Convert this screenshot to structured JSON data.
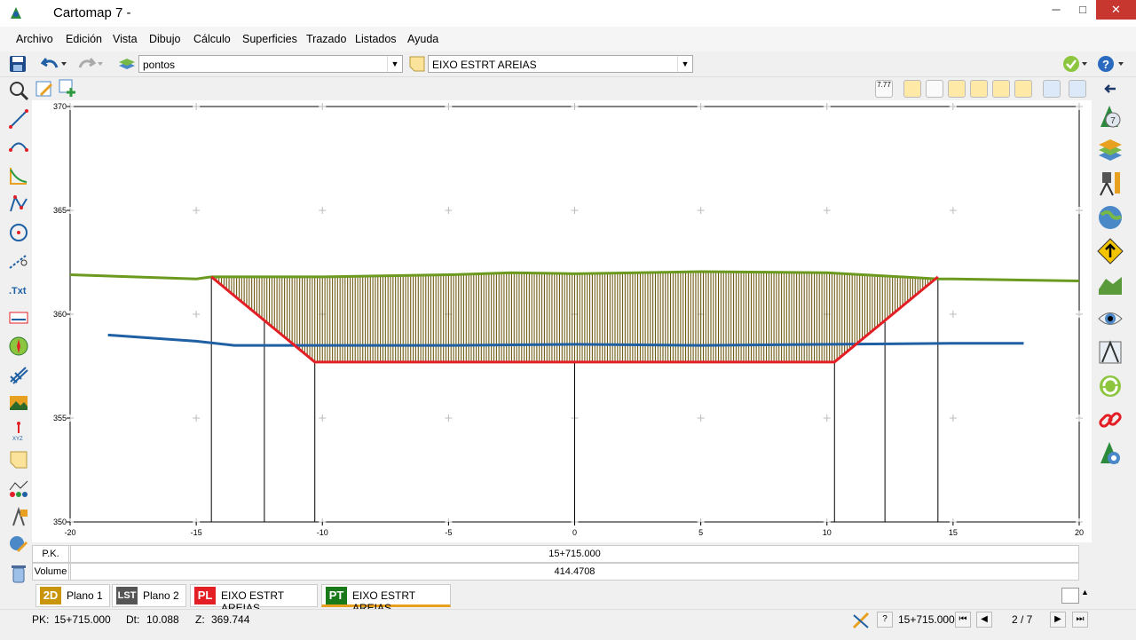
{
  "window": {
    "title": "Cartomap 7 -",
    "minimize": "─",
    "maximize": "□",
    "close": "✕"
  },
  "menu": [
    "Archivo",
    "Edición",
    "Vista",
    "Dibujo",
    "Cálculo",
    "Superficies",
    "Trazado",
    "Listados",
    "Ayuda"
  ],
  "toolbar": {
    "layer_combo": "pontos",
    "alignment_combo": "EIXO ESTRT AREIAS",
    "scale_label": "7.77"
  },
  "info": {
    "pk_label": "P.K.",
    "pk_value": "15+715.000",
    "volume_label": "Volume",
    "volume_value": "414.4708"
  },
  "tabs": [
    {
      "badge": "2D",
      "label": "Plano 1",
      "color": "#c8950c"
    },
    {
      "badge": "LST",
      "label": "Plano 2",
      "color": "#555555"
    },
    {
      "badge": "PL",
      "label": "EIXO ESTRT AREIAS",
      "color": "#e31e24"
    },
    {
      "badge": "PT",
      "label": "EIXO ESTRT AREIAS",
      "color": "#1a7a1a"
    }
  ],
  "status": {
    "pk_label": "PK:",
    "pk_value": "15+715.000",
    "dt_label": "Dt:",
    "dt_value": "10.088",
    "z_label": "Z:",
    "z_value": "369.744",
    "nav_pk": "15+715.000",
    "page": "2 / 7"
  },
  "chart_data": {
    "type": "line",
    "xlim": [
      -20,
      20
    ],
    "ylim": [
      350,
      370
    ],
    "x_ticks": [
      "-20",
      "-15",
      "-10",
      "-5",
      "0",
      "5",
      "10",
      "15",
      "20"
    ],
    "y_ticks": [
      "370",
      "365",
      "360",
      "355",
      "350"
    ],
    "series": [
      {
        "name": "",
        "color": "#6b9a1e",
        "x": [
          -20,
          -15,
          -14.4,
          -10,
          -5,
          -2.5,
          0,
          2.5,
          5,
          10,
          14.4,
          15,
          20
        ],
        "y": [
          361.9,
          361.7,
          361.8,
          361.8,
          361.9,
          362.0,
          361.95,
          362.0,
          362.05,
          362.0,
          361.7,
          361.7,
          361.6
        ]
      },
      {
        "name": "",
        "color": "#1f5fa3",
        "x": [
          -18.5,
          -15,
          -13.5,
          -12,
          -5,
          0,
          5,
          10,
          15,
          17.8
        ],
        "y": [
          359.0,
          358.7,
          358.5,
          358.5,
          358.5,
          358.55,
          358.5,
          358.55,
          358.6,
          358.6
        ]
      },
      {
        "name": "",
        "color": "#e31e24",
        "x": [
          -14.4,
          -10.3,
          10.3,
          14.4
        ],
        "y": [
          361.8,
          357.7,
          357.7,
          361.8
        ]
      }
    ],
    "fill": {
      "color": "#6e5a12",
      "between": "terrain and design"
    },
    "verticals": [
      -14.4,
      -12.3,
      -10.3,
      0,
      10.3,
      12.3,
      14.4
    ]
  }
}
